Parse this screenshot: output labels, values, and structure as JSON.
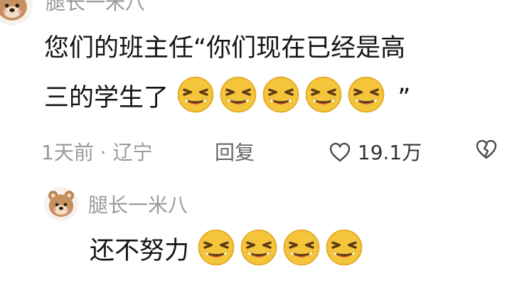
{
  "main_comment": {
    "username": "腿长一米八",
    "line1": "您们的班主任“你们现在已经是高",
    "line2": "三的学生了",
    "closing_quote": "”",
    "emoji_count": 5,
    "time_location": "1天前 · 辽宁",
    "reply_label": "回复",
    "like_count": "19.1万",
    "avatar_icon": "bear-avatar-icon",
    "emoji_icon": "grinning-squint-emoji"
  },
  "reply": {
    "username": "腿长一米八",
    "text": "还不努力",
    "emoji_count": 4,
    "avatar_icon": "bear-avatar-icon",
    "emoji_icon": "grinning-squint-emoji"
  },
  "colors": {
    "meta_gray": "#9a9a9a",
    "text": "#141414",
    "emoji_yellow": "#f4c53b"
  }
}
